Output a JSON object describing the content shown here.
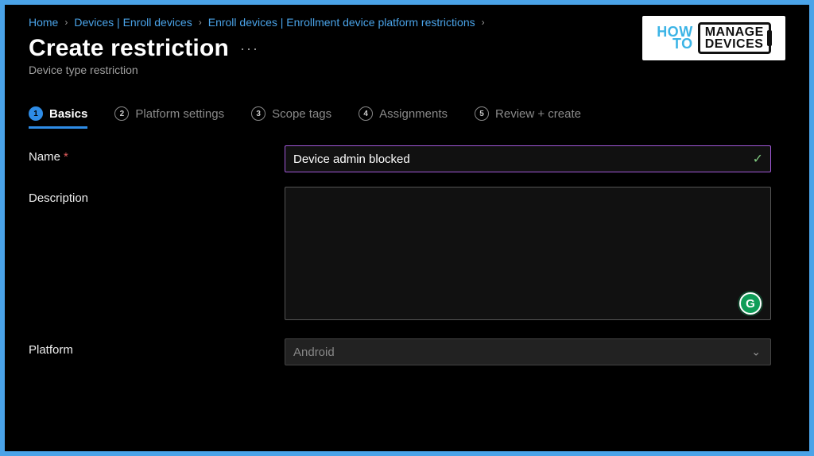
{
  "breadcrumb": {
    "items": [
      "Home",
      "Devices | Enroll devices",
      "Enroll devices | Enrollment device platform restrictions"
    ]
  },
  "header": {
    "title": "Create restriction",
    "subtitle": "Device type restriction",
    "more": "···"
  },
  "logo": {
    "how": "HOW",
    "to": "TO",
    "line1": "MANAGE",
    "line2": "DEVICES"
  },
  "tabs": [
    {
      "num": "1",
      "label": "Basics"
    },
    {
      "num": "2",
      "label": "Platform settings"
    },
    {
      "num": "3",
      "label": "Scope tags"
    },
    {
      "num": "4",
      "label": "Assignments"
    },
    {
      "num": "5",
      "label": "Review + create"
    }
  ],
  "form": {
    "name_label": "Name",
    "required": "*",
    "name_value": "Device admin blocked",
    "description_label": "Description",
    "description_value": "",
    "platform_label": "Platform",
    "platform_value": "Android",
    "grammarly": "G",
    "checkmark": "✓",
    "caret": "⌄"
  }
}
